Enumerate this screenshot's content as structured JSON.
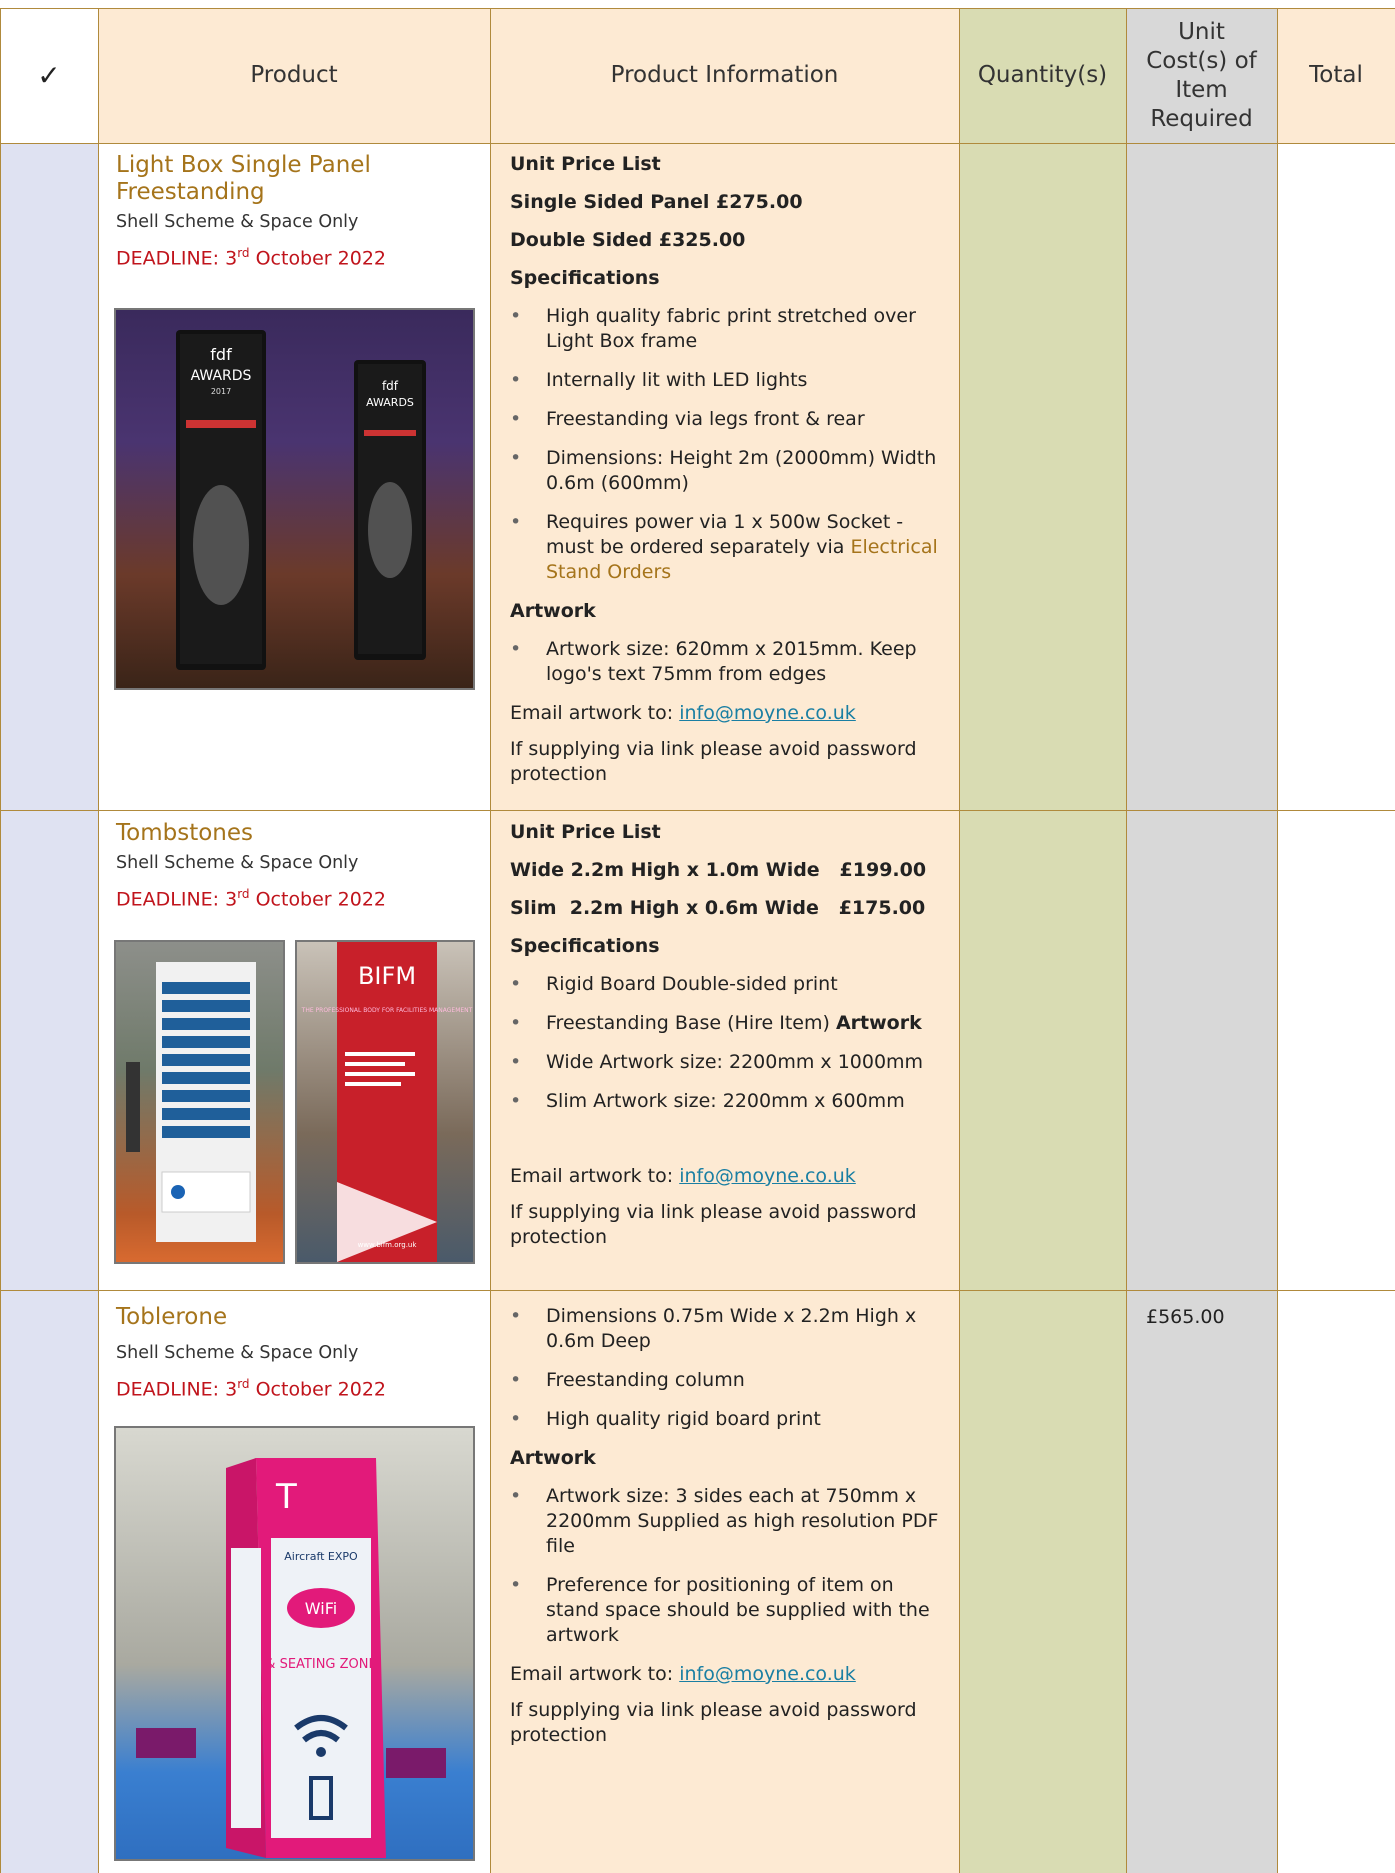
{
  "header": {
    "check": "✓",
    "product": "Product",
    "info": "Product Information",
    "quantity": "Quantity(s)",
    "unit_cost": "Unit Cost(s) of Item Required",
    "total": "Total"
  },
  "colors": {
    "peach": "#fdead3",
    "olive": "#d9dcb3",
    "grey": "#d8d8d8",
    "lavender": "#dfe2f2",
    "border": "#b08a3c",
    "title": "#a5741b",
    "deadline": "#c0141c",
    "link": "#1a7fa3"
  },
  "products": [
    {
      "title": "Light Box Single Panel Freestanding",
      "subtitle": "Shell Scheme & Space Only",
      "deadline_prefix": "DEADLINE: 3",
      "deadline_sup": "rd",
      "deadline_suffix": " October 2022",
      "price_heading": "Unit Price List",
      "price_line_1": "Single Sided Panel £275.00",
      "price_line_2": "Double Sided £325.00",
      "spec_heading": "Specifications",
      "specs": [
        "High quality fabric print stretched over Light Box frame",
        "Internally lit with LED lights",
        "Freestanding via legs front & rear",
        "Dimensions: Height 2m (2000mm) Width 0.6m (600mm)",
        "Requires power via 1 x 500w Socket - must be ordered separately via"
      ],
      "spec_link": "Electrical Stand Orders",
      "artwork_heading": "Artwork",
      "artwork": [
        "Artwork size: 620mm x 2015mm. Keep logo's text 75mm from edges"
      ],
      "email_label": "Email artwork  to: ",
      "email": "info@moyne.co.uk",
      "link_note": "If supplying via link please avoid password protection",
      "image_text": [
        "fdf",
        "AWARDS",
        "2017"
      ]
    },
    {
      "title": "Tombstones",
      "subtitle": "Shell Scheme & Space Only",
      "deadline_prefix": "DEADLINE: 3",
      "deadline_sup": "rd",
      "deadline_suffix": " October 2022",
      "price_heading": "Unit Price List",
      "price_line_1": "Wide 2.2m High x 1.0m Wide   £199.00",
      "price_line_2": "Slim  2.2m High x 0.6m Wide   £175.00",
      "spec_heading": "Specifications",
      "spec_1": "Rigid Board Double-sided print",
      "spec_2": "Freestanding Base (Hire Item) ",
      "spec_2_bold": "Artwork",
      "spec_3": "Wide Artwork size: 2200mm x 1000mm",
      "spec_4": "Slim Artwork size: 2200mm x 600mm",
      "email_label": "Email artwork  to: ",
      "email": "info@moyne.co.uk",
      "link_note": "If supplying via link please avoid password protection",
      "image_text": [
        "BIFM",
        "THE PROFESSIONAL BODY FOR FACILITIES MANAGEMENT",
        "www.bifm.org.uk"
      ]
    },
    {
      "title": "Toblerone",
      "subtitle": "Shell Scheme & Space Only",
      "deadline_prefix": "DEADLINE: 3",
      "deadline_sup": "rd",
      "deadline_suffix": " October 2022",
      "specs": [
        "Dimensions 0.75m Wide x 2.2m High x 0.6m Deep",
        "Freestanding column",
        "High quality rigid board print"
      ],
      "artwork_heading": "Artwork",
      "artwork": [
        "Artwork size: 3 sides each at 750mm x 2200mm Supplied as high resolution PDF file",
        "Preference for positioning of item on stand space should be supplied with the artwork"
      ],
      "email_label": "Email artwork to: ",
      "email": "info@moyne.co.uk",
      "link_note": "If supplying via link please avoid password protection",
      "unit_cost": "£565.00",
      "image_text": [
        "T",
        "Aircraft EXPO",
        "WiFi",
        "& SEATING ZONE"
      ]
    }
  ]
}
